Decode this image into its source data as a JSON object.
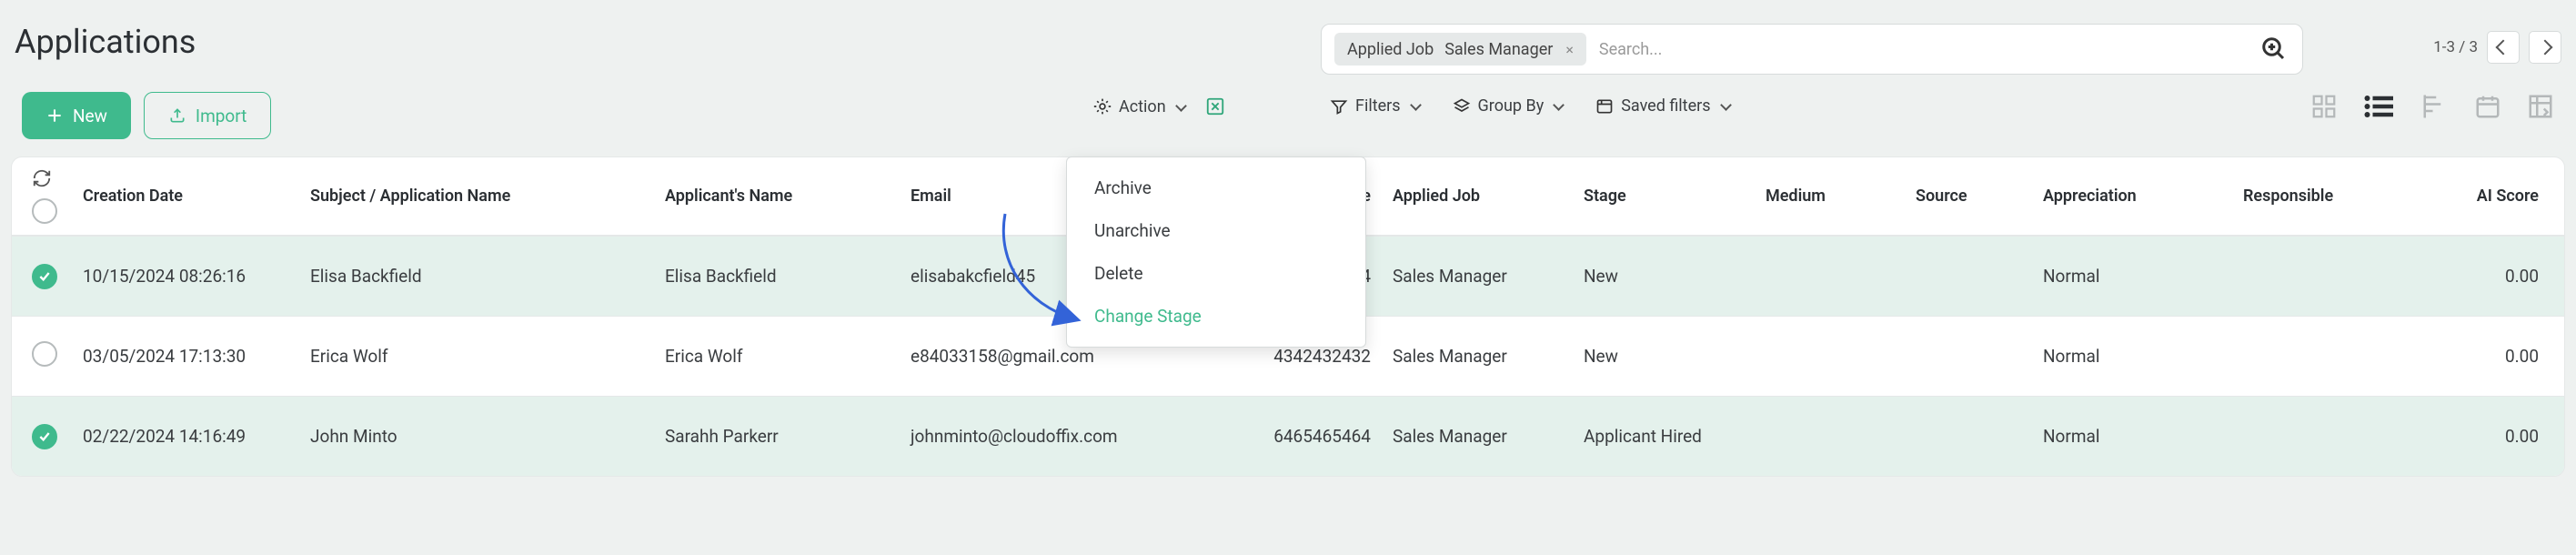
{
  "title": "Applications",
  "new_label": "New",
  "import_label": "Import",
  "search": {
    "facet": "Applied Job",
    "value": "Sales Manager",
    "placeholder": "Search..."
  },
  "pager": {
    "text": "1-3 / 3"
  },
  "action_label": "Action",
  "filters_label": "Filters",
  "groupby_label": "Group By",
  "saved_filters_label": "Saved filters",
  "menu": {
    "archive": "Archive",
    "unarchive": "Unarchive",
    "delete": "Delete",
    "change_stage": "Change Stage"
  },
  "columns": {
    "date": "Creation Date",
    "subject": "Subject / Application Name",
    "applicant": "Applicant's Name",
    "email": "Email",
    "phone": "Phone",
    "applied_job": "Applied Job",
    "stage": "Stage",
    "medium": "Medium",
    "source": "Source",
    "appreciation": "Appreciation",
    "responsible": "Responsible",
    "ai_score": "AI Score"
  },
  "rows": [
    {
      "selected": true,
      "date": "10/15/2024 08:26:16",
      "subject": "Elisa Backfield",
      "applicant": "Elisa Backfield",
      "email": "elisabakcfield45",
      "phone": "4",
      "applied_job": "Sales Manager",
      "stage": "New",
      "medium": "",
      "source": "",
      "appreciation": "Normal",
      "responsible": "",
      "ai_score": "0.00"
    },
    {
      "selected": false,
      "date": "03/05/2024 17:13:30",
      "subject": "Erica Wolf",
      "applicant": "Erica Wolf",
      "email": "e84033158@gmail.com",
      "phone": "4342432432",
      "applied_job": "Sales Manager",
      "stage": "New",
      "medium": "",
      "source": "",
      "appreciation": "Normal",
      "responsible": "",
      "ai_score": "0.00"
    },
    {
      "selected": true,
      "date": "02/22/2024 14:16:49",
      "subject": "John Minto",
      "applicant": "Sarahh Parkerr",
      "email": "johnminto@cloudoffix.com",
      "phone": "6465465464",
      "applied_job": "Sales Manager",
      "stage": "Applicant Hired",
      "medium": "",
      "source": "",
      "appreciation": "Normal",
      "responsible": "",
      "ai_score": "0.00"
    }
  ]
}
